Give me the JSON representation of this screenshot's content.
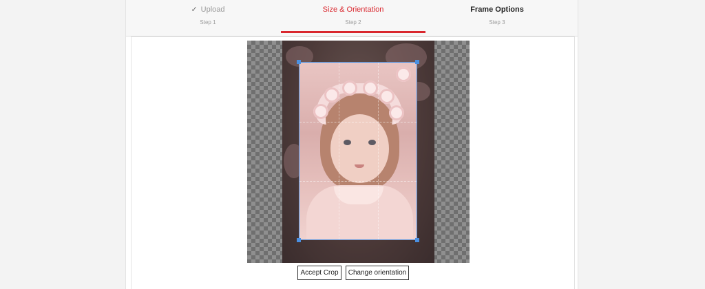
{
  "steps": [
    {
      "title": "Upload",
      "subtitle": "Step 1",
      "state": "completed",
      "icon": "check-icon",
      "check_glyph": "✓"
    },
    {
      "title": "Size & Orientation",
      "subtitle": "Step 2",
      "state": "active"
    },
    {
      "title": "Frame Options",
      "subtitle": "Step 3",
      "state": "upcoming"
    }
  ],
  "editor": {
    "image_alt": "Toddler with pink flower crown",
    "accept_crop_label": "Accept Crop",
    "change_orientation_label": "Change orientation"
  },
  "colors": {
    "accent": "#d9272e",
    "crop_border": "#4a90e2"
  }
}
